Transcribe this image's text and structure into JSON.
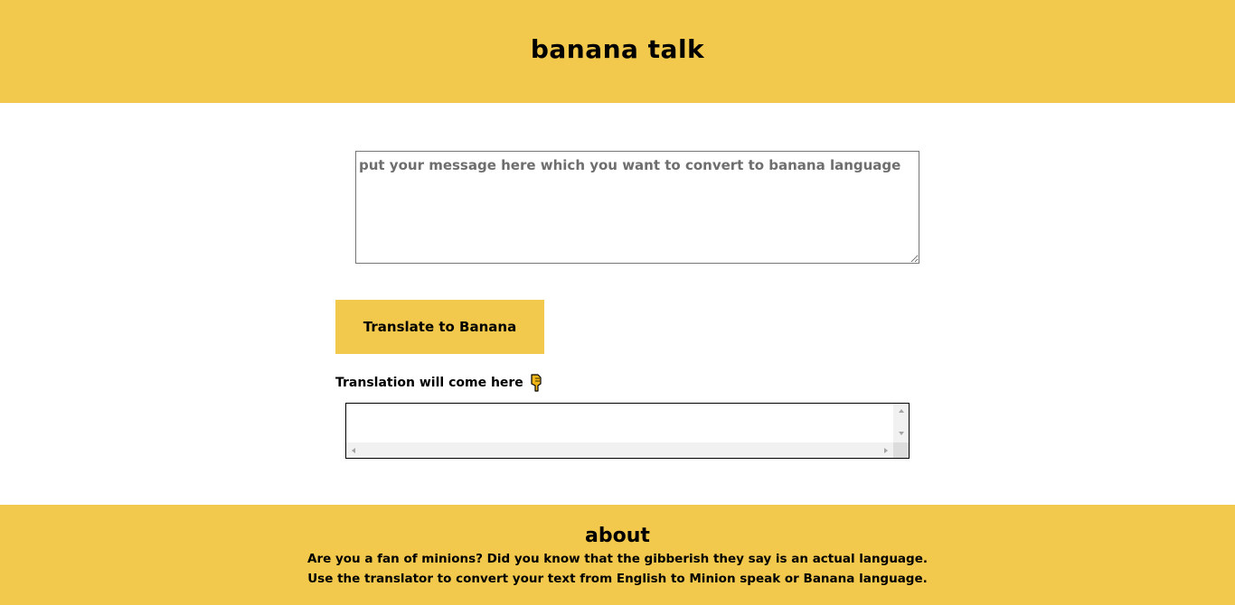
{
  "header": {
    "title": "banana talk"
  },
  "input": {
    "placeholder": "put your message here which you want to convert to banana language",
    "value": ""
  },
  "translate_button": {
    "label": "Translate to Banana"
  },
  "output": {
    "label": "Translation will come here",
    "label_icon": "pointing-down-hand-icon",
    "value": ""
  },
  "footer": {
    "title": "about",
    "lines": [
      "Are you a fan of minions? Did you know that the gibberish they say is an actual language.",
      "Use the translator to convert your text from English to Minion speak or Banana language."
    ]
  },
  "colors": {
    "accent": "#f2c94c",
    "background": "#ffffff",
    "text": "#000000"
  }
}
